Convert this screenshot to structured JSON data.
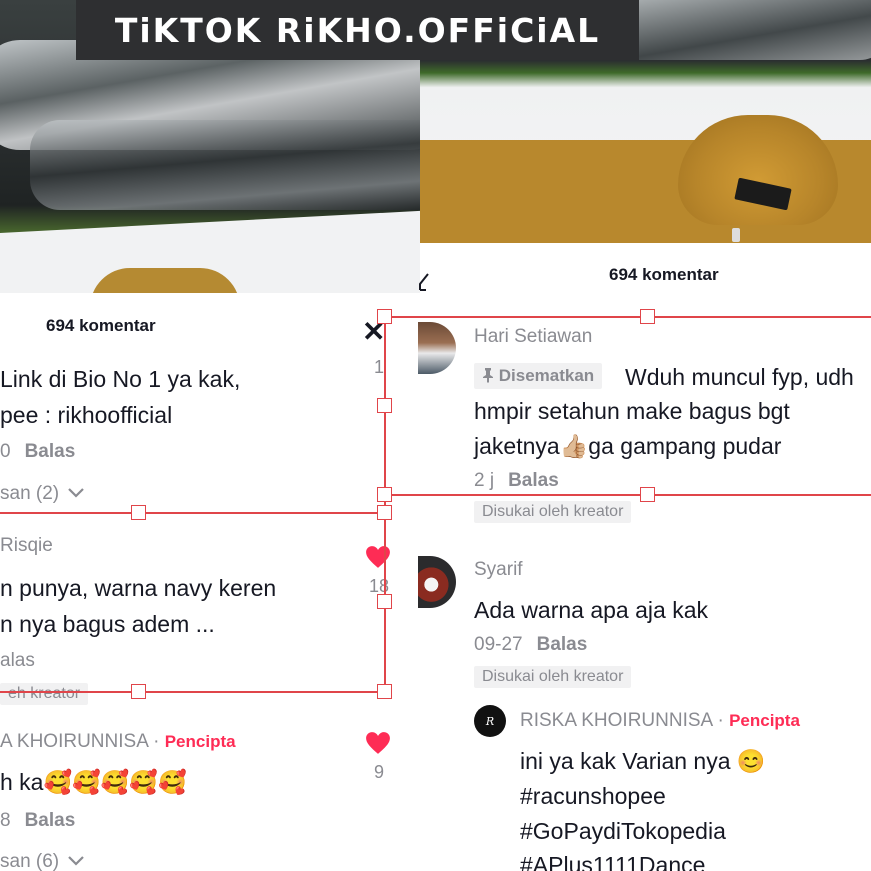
{
  "banner": {
    "text": "TiKTOK RiKHO.OFFiCiAL"
  },
  "left_panel": {
    "comment_count": "694 komentar",
    "comments": [
      {
        "text_line1": "Link di Bio No 1 ya kak,",
        "text_line2": "pee : rikhoofficial",
        "time": "0",
        "reply": "Balas",
        "view_replies": "san (2)",
        "likes": "1"
      },
      {
        "name": "Risqie",
        "text_line1": "n punya, warna navy keren",
        "text_line2": "n nya bagus adem ...",
        "reply": "alas",
        "liked_by": "eh kreator",
        "likes": "18"
      },
      {
        "name": "A KHOIRUNNISA",
        "badge": "Pencipta",
        "text_line1": "h ka🥰🥰🥰🥰🥰",
        "time": "8",
        "reply": "Balas",
        "view_replies": "san (6)",
        "likes": "9"
      }
    ]
  },
  "right_panel": {
    "comment_count": "694 komentar",
    "comments": [
      {
        "name": "Hari Setiawan",
        "pinned": "Disematkan",
        "text_line1": "Wduh muncul fyp, udh",
        "text_line2": "hmpir setahun make bagus bgt",
        "text_line3": "jaketnya👍🏼ga gampang pudar",
        "time": "2 j",
        "reply": "Balas",
        "liked_by": "Disukai oleh kreator"
      },
      {
        "name": "Syarif",
        "text_line1": "Ada warna apa aja kak",
        "time": "09-27",
        "reply": "Balas",
        "liked_by": "Disukai oleh kreator"
      },
      {
        "name": "RISKA KHOIRUNNISA",
        "badge": "Pencipta",
        "text_line1": "ini ya kak Varian nya 😊",
        "text_line2": "#racunshopee",
        "text_line3": "#GoPaydiTokopedia",
        "text_line4": "#APlus1111Dance"
      }
    ]
  },
  "colors": {
    "creator_badge": "#fe2c55",
    "selection": "#e0454a",
    "heart": "#fe2c55"
  }
}
